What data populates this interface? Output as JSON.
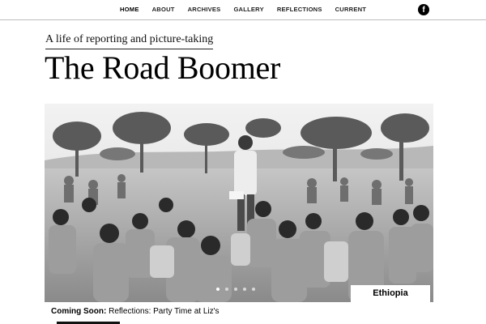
{
  "nav": {
    "items": [
      {
        "label": "HOME",
        "active": true
      },
      {
        "label": "ABOUT",
        "active": false
      },
      {
        "label": "ARCHIVES",
        "active": false
      },
      {
        "label": "GALLERY",
        "active": false
      },
      {
        "label": "REFLECTIONS",
        "active": false
      },
      {
        "label": "CURRENT",
        "active": false
      }
    ],
    "social_icon": "facebook-icon",
    "social_glyph": "f"
  },
  "header": {
    "tagline": "A life of reporting and picture-taking",
    "title": "The Road Boomer"
  },
  "slideshow": {
    "caption": "Ethiopia",
    "slide_count": 5,
    "active_slide": 1
  },
  "footer": {
    "coming_soon_label": "Coming Soon:",
    "coming_soon_text": " Reflections: Party Time at Liz's"
  },
  "colors": {
    "background": "#ffffff",
    "text": "#111111",
    "accent": "#000000"
  }
}
